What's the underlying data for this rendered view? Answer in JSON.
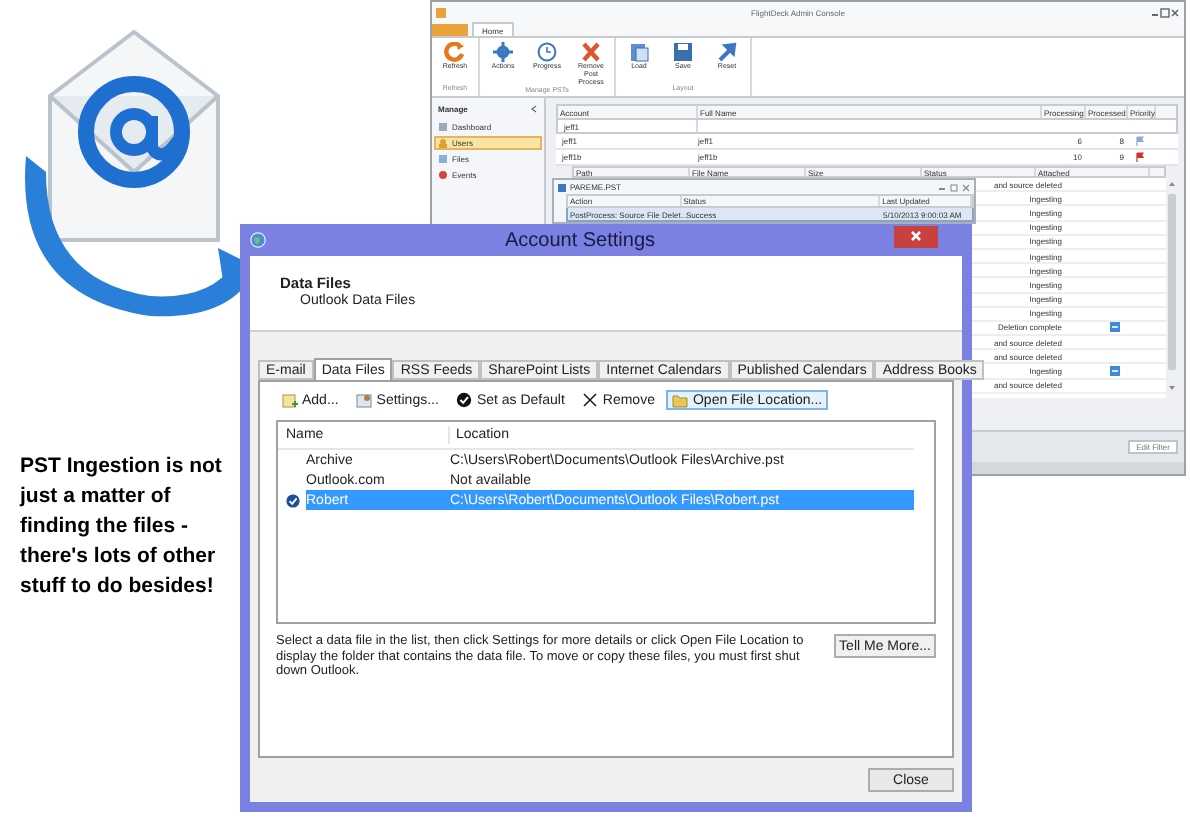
{
  "caption": "PST Ingestion is not just a matter of finding the files - there's lots of other stuff to do besides!",
  "admin_console": {
    "title": "FlightDeck Admin Console",
    "ribbon_tabs": [
      {
        "label": "Home",
        "selected": true
      }
    ],
    "ribbon_groups": [
      {
        "label": "Refresh",
        "buttons": [
          "Refresh"
        ]
      },
      {
        "label": "Manage PSTs",
        "buttons": [
          "Actions",
          "Progress",
          "Remove Post Process"
        ]
      },
      {
        "label": "Layout",
        "buttons": [
          "Load",
          "Save",
          "Reset"
        ]
      }
    ],
    "sidebar": {
      "title": "Manage",
      "items": [
        {
          "label": "Dashboard",
          "selected": false
        },
        {
          "label": "Users",
          "selected": true
        },
        {
          "label": "Files",
          "selected": false
        },
        {
          "label": "Events",
          "selected": false
        }
      ]
    },
    "users_grid": {
      "columns": [
        "Account",
        "Full Name",
        "Processing",
        "Processed",
        "Priority"
      ],
      "filter": "jeff1",
      "rows": [
        {
          "account": "jeff1",
          "full_name": "jeff1",
          "processing": "6",
          "processed": "8",
          "color": "#8fa9d6"
        },
        {
          "account": "jeff1b",
          "full_name": "jeff1b",
          "processing": "10",
          "processed": "9",
          "color": "#d0302a"
        }
      ]
    },
    "files_grid": {
      "columns": [
        "Path",
        "File Name",
        "Size",
        "Status",
        "Attached"
      ],
      "rows": [
        {
          "status": "and source deleted",
          "attached": false
        },
        {
          "status": "Ingesting",
          "attached": false
        },
        {
          "status": "Ingesting",
          "attached": false
        },
        {
          "status": "Ingesting",
          "attached": false
        },
        {
          "status": "Ingesting",
          "attached": false
        },
        {
          "status": "Ingesting",
          "attached": false
        },
        {
          "status": "Ingesting",
          "attached": false
        },
        {
          "status": "Ingesting",
          "attached": false
        },
        {
          "status": "Ingesting",
          "attached": false
        },
        {
          "status": "Ingesting",
          "attached": false
        },
        {
          "status": "Deletion complete",
          "attached": true
        },
        {
          "status": "and source deleted",
          "attached": false
        },
        {
          "status": "and source deleted",
          "attached": false
        },
        {
          "status": "Ingesting",
          "attached": true
        },
        {
          "status": "and source deleted",
          "attached": false
        }
      ]
    },
    "popup": {
      "title": "PAREME.PST",
      "columns": [
        "Action",
        "Status",
        "Last Updated"
      ],
      "rows": [
        {
          "action": "PostProcess: Source File Delet...",
          "status": "Success",
          "last_updated": "5/10/2013 9:00:03 AM"
        }
      ]
    },
    "edit_filter": "Edit Filter"
  },
  "dialog": {
    "title": "Account Settings",
    "heading": "Data Files",
    "subheading": "Outlook Data Files",
    "tabs": [
      {
        "label": "E-mail",
        "selected": false
      },
      {
        "label": "Data Files",
        "selected": true
      },
      {
        "label": "RSS Feeds",
        "selected": false
      },
      {
        "label": "SharePoint Lists",
        "selected": false
      },
      {
        "label": "Internet Calendars",
        "selected": false
      },
      {
        "label": "Published Calendars",
        "selected": false
      },
      {
        "label": "Address Books",
        "selected": false
      }
    ],
    "toolbar": [
      {
        "label": "Add...",
        "hovered": false
      },
      {
        "label": "Settings...",
        "hovered": false
      },
      {
        "label": "Set as Default",
        "hovered": false
      },
      {
        "label": "Remove",
        "hovered": false
      },
      {
        "label": "Open File Location...",
        "hovered": true
      }
    ],
    "columns": [
      "Name",
      "Location"
    ],
    "files": [
      {
        "name": "Archive",
        "location": "C:\\Users\\Robert\\Documents\\Outlook Files\\Archive.pst",
        "selected": false,
        "default": false
      },
      {
        "name": "Outlook.com",
        "location": "Not available",
        "selected": false,
        "default": false
      },
      {
        "name": "Robert",
        "location": "C:\\Users\\Robert\\Documents\\Outlook Files\\Robert.pst",
        "selected": true,
        "default": true
      }
    ],
    "description": "Select a data file in the list, then click Settings for more details or click Open File Location to display the folder that contains the data file. To move or copy these files, you must first shut down Outlook.",
    "tell_me_more": "Tell Me More...",
    "close": "Close"
  }
}
